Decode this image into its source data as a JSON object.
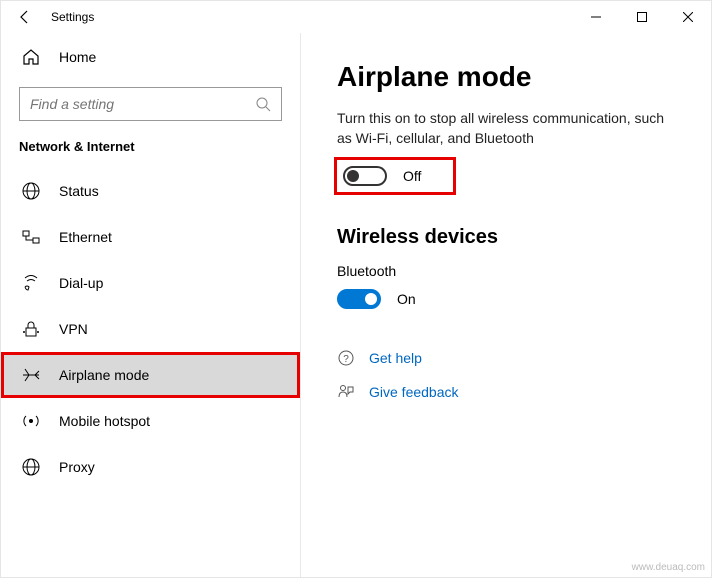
{
  "header": {
    "title": "Settings"
  },
  "sidebar": {
    "home": "Home",
    "search_placeholder": "Find a setting",
    "category": "Network & Internet",
    "items": [
      {
        "label": "Status"
      },
      {
        "label": "Ethernet"
      },
      {
        "label": "Dial-up"
      },
      {
        "label": "VPN"
      },
      {
        "label": "Airplane mode"
      },
      {
        "label": "Mobile hotspot"
      },
      {
        "label": "Proxy"
      }
    ]
  },
  "main": {
    "title": "Airplane mode",
    "description": "Turn this on to stop all wireless communication, such as Wi-Fi, cellular, and Bluetooth",
    "airplane_toggle_label": "Off",
    "wireless_heading": "Wireless devices",
    "bluetooth_label": "Bluetooth",
    "bluetooth_toggle_label": "On"
  },
  "links": {
    "help": "Get help",
    "feedback": "Give feedback"
  },
  "watermark": "www.deuaq.com"
}
